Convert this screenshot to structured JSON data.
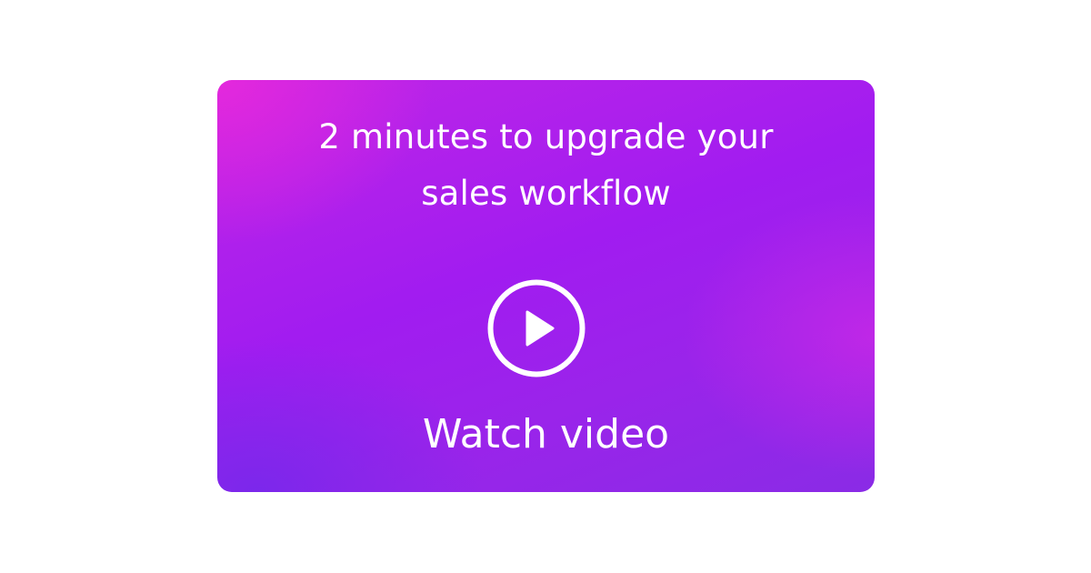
{
  "card": {
    "headline_line1": "2 minutes to upgrade your",
    "headline_line2": "sales workflow",
    "cta_label": "Watch video",
    "play_icon": "play-circle-icon"
  },
  "colors": {
    "background": "#ffffff",
    "card_gradient_pink": "#e628dc",
    "card_gradient_purple": "#a11cf0",
    "card_gradient_violet": "#8a2be6",
    "text": "#ffffff"
  }
}
